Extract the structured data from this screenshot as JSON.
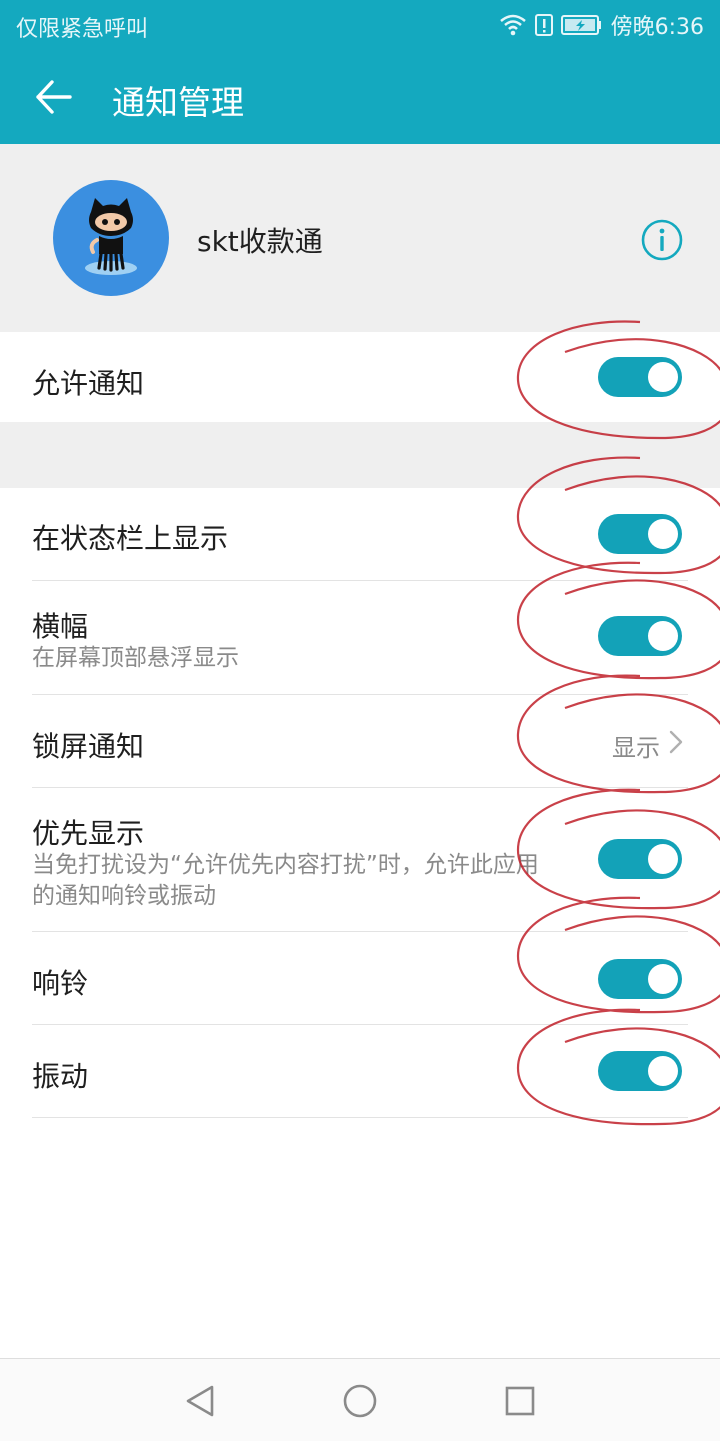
{
  "status_bar": {
    "carrier": "仅限紧急呼叫",
    "time": "傍晚6:36",
    "icons": [
      "wifi-icon",
      "alert-icon",
      "battery-charging-icon"
    ]
  },
  "app_bar": {
    "title": "通知管理",
    "back_icon": "arrow-left-icon"
  },
  "app": {
    "name": "skt收款通",
    "avatar_icon": "octocat-avatar",
    "info_icon": "info-circle-icon"
  },
  "settings": {
    "allow": {
      "label": "允许通知",
      "on": true
    },
    "statusbar": {
      "label": "在状态栏上显示",
      "on": true
    },
    "banner": {
      "label": "横幅",
      "sub": "在屏幕顶部悬浮显示",
      "on": true
    },
    "lockscreen": {
      "label": "锁屏通知",
      "value": "显示"
    },
    "priority": {
      "label": "优先显示",
      "sub": "当免打扰设为“允许优先内容打扰”时，允许此应用的通知响铃或振动",
      "on": true
    },
    "ring": {
      "label": "响铃",
      "on": true
    },
    "vibrate": {
      "label": "振动",
      "on": true
    }
  },
  "colors": {
    "accent": "#14a9bf",
    "toggle_on": "#13a2b8",
    "annotation": "#c0202a"
  },
  "nav": {
    "icons": [
      "back-triangle-icon",
      "home-circle-icon",
      "recents-square-icon"
    ]
  }
}
